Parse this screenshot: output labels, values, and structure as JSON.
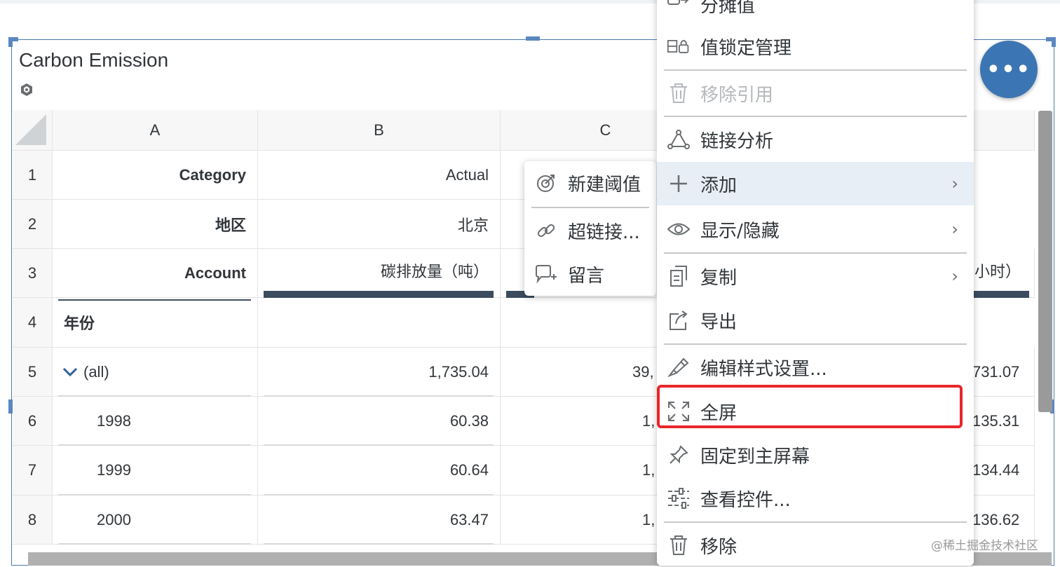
{
  "widget": {
    "title": "Carbon Emission",
    "more_button": "•••",
    "model_icon": "cube-icon"
  },
  "table": {
    "column_headers": [
      "A",
      "B",
      "C"
    ],
    "row_headers": [
      "1",
      "2",
      "3",
      "4",
      "5",
      "6",
      "7",
      "8"
    ],
    "colA": [
      "Category",
      "地区",
      "Account",
      "年份",
      "(all)",
      "1998",
      "1999",
      "2000"
    ],
    "colB": [
      "Actual",
      "北京",
      "碳排放量（吨）",
      "",
      "1,735.04",
      "60.38",
      "60.64",
      "63.47"
    ],
    "colC": [
      "",
      "",
      "",
      "",
      "39,",
      "1,",
      "1,",
      "1,"
    ],
    "colE": [
      "",
      "",
      "小时）",
      "",
      "731.07",
      "135.31",
      "134.44",
      "136.62"
    ]
  },
  "main_menu": {
    "items": [
      {
        "label": "分摊值",
        "icon": "allocate-icon"
      },
      {
        "label": "值锁定管理",
        "icon": "value-lock-icon"
      },
      {
        "label": "移除引用",
        "icon": "trash-icon",
        "disabled": true
      },
      {
        "label": "链接分析",
        "icon": "link-analysis-icon"
      },
      {
        "label": "添加",
        "icon": "plus-icon",
        "submenu": true
      },
      {
        "label": "显示/隐藏",
        "icon": "eye-icon",
        "submenu": true
      },
      {
        "label": "复制",
        "icon": "copy-icon",
        "submenu": true
      },
      {
        "label": "导出",
        "icon": "export-icon"
      },
      {
        "label": "编辑样式设置...",
        "icon": "style-brush-icon"
      },
      {
        "label": "全屏",
        "icon": "fullscreen-icon"
      },
      {
        "label": "固定到主屏幕",
        "icon": "pin-icon"
      },
      {
        "label": "查看控件...",
        "icon": "controls-icon"
      },
      {
        "label": "移除",
        "icon": "trash-icon"
      }
    ],
    "chevron": "›"
  },
  "sub_menu": {
    "items": [
      {
        "label": "新建阈值",
        "icon": "target-icon"
      },
      {
        "label": "超链接...",
        "icon": "hyperlink-icon"
      },
      {
        "label": "留言",
        "icon": "comment-add-icon"
      }
    ]
  },
  "watermark": "@稀土掘金技术社区",
  "colors": {
    "accent": "#3c75b3",
    "highlight": "#e8262a",
    "header_bar": "#3b4c5e"
  }
}
